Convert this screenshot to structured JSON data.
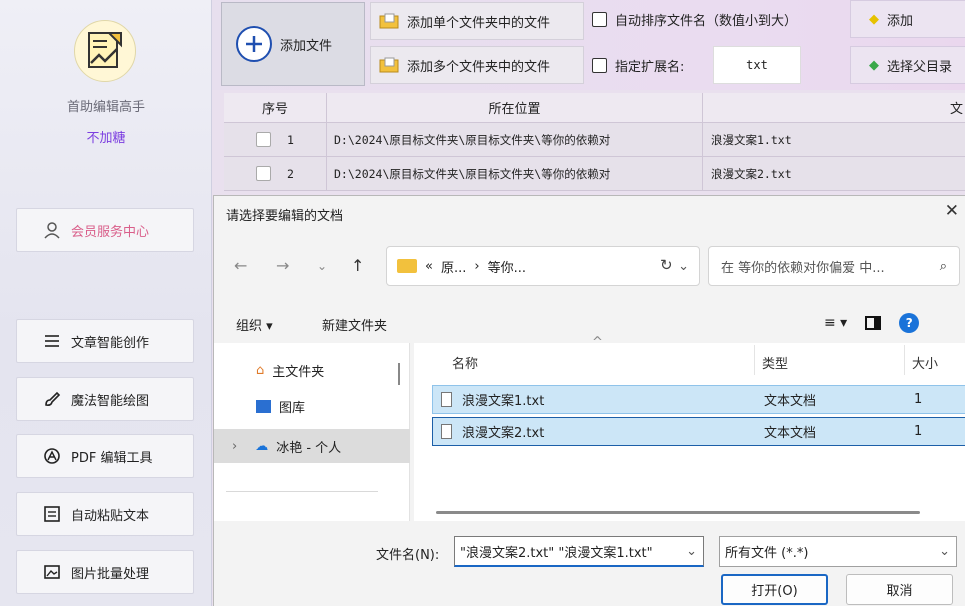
{
  "sidebar": {
    "app_name": "首助编辑高手",
    "app_sub": "不加糖",
    "member": "会员服务中心",
    "items": [
      {
        "label": "文章智能创作"
      },
      {
        "label": "魔法智能绘图"
      },
      {
        "label": "PDF 编辑工具"
      },
      {
        "label": "自动粘贴文本"
      },
      {
        "label": "图片批量处理"
      }
    ]
  },
  "toolbar": {
    "add_file": "添加文件",
    "add_single": "添加单个文件夹中的文件",
    "add_multi": "添加多个文件夹中的文件",
    "auto_sort": "自动排序文件名（数值小到大）",
    "ext_label": "指定扩展名:",
    "ext_value": "txt",
    "right_top": "添加",
    "right_bottom": "选择父目录"
  },
  "table": {
    "headers": [
      "序号",
      "所在位置",
      "文"
    ],
    "rows": [
      {
        "index": "1",
        "location": "D:\\2024\\原目标文件夹\\原目标文件夹\\等你的依赖对",
        "name": "浪漫文案1.txt"
      },
      {
        "index": "2",
        "location": "D:\\2024\\原目标文件夹\\原目标文件夹\\等你的依赖对",
        "name": "浪漫文案2.txt"
      }
    ]
  },
  "dialog": {
    "title": "请选择要编辑的文档",
    "close": "✕",
    "address": {
      "prefix": "«",
      "crumb1": "原...",
      "sep": "›",
      "crumb2": "等你..."
    },
    "search_placeholder": "在 等你的依赖对你偏爱 中...",
    "organize": "组织 ▾",
    "new_folder": "新建文件夹",
    "nav": [
      {
        "label": "主文件夹"
      },
      {
        "label": "图库"
      },
      {
        "label": "冰艳 - 个人"
      }
    ],
    "columns": {
      "name": "名称",
      "type": "类型",
      "size": "大小"
    },
    "files": [
      {
        "name": "浪漫文案1.txt",
        "type": "文本文档",
        "size": "1"
      },
      {
        "name": "浪漫文案2.txt",
        "type": "文本文档",
        "size": "1"
      }
    ],
    "filename_label": "文件名(N):",
    "filename_value": "\"浪漫文案2.txt\" \"浪漫文案1.txt\"",
    "filetype_value": "所有文件 (*.*)",
    "open": "打开(O)",
    "cancel": "取消"
  }
}
